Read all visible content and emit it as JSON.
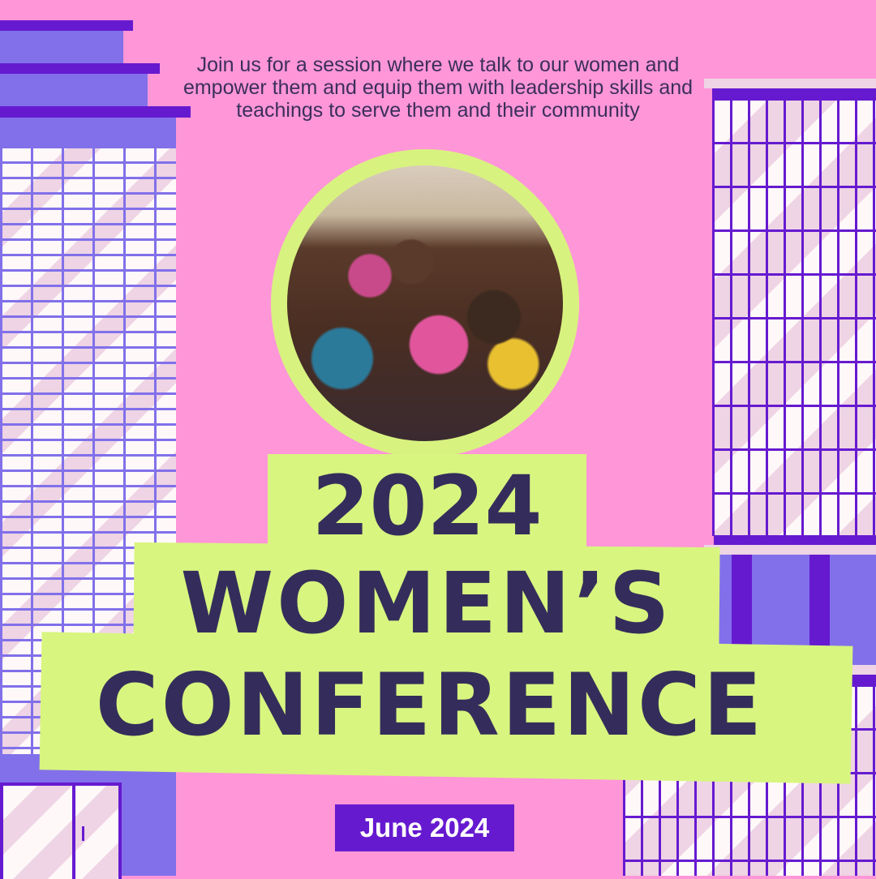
{
  "intro": {
    "text": "Join us for a session where we talk to our women and empower them and equip them with leadership skills and teachings to serve them and their community"
  },
  "title": {
    "year": "2024",
    "line2": "WOMEN’S",
    "line3": "CONFERENCE"
  },
  "date": {
    "label": "June 2024"
  },
  "photo": {
    "alt": "group-of-women-cheering"
  },
  "colors": {
    "background": "#ff96d8",
    "accent_purple": "#661ad0",
    "banner_green": "#d8f57f",
    "title_text": "#342d5b"
  }
}
